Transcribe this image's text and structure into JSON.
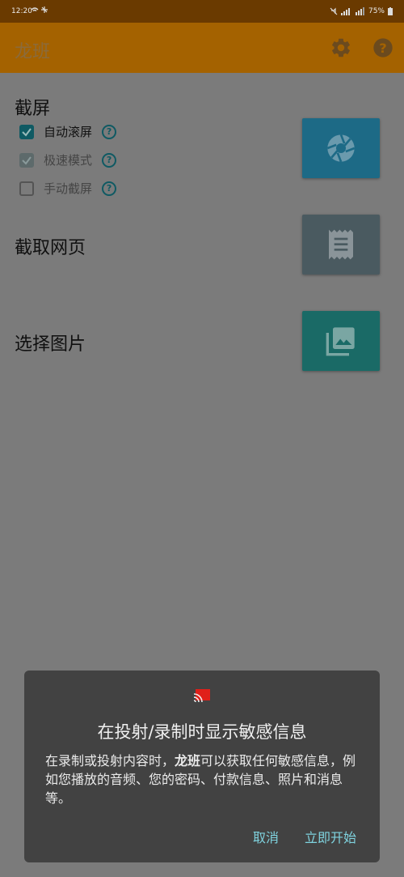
{
  "status_bar": {
    "time": "12:20",
    "battery": "75%"
  },
  "app_bar": {
    "title": "龙班",
    "settings_icon": "gear-icon",
    "help_icon": "help-icon"
  },
  "screenshot_section": {
    "title": "截屏",
    "options": [
      {
        "label": "自动滚屏",
        "checked": true,
        "enabled": true
      },
      {
        "label": "极速模式",
        "checked": true,
        "enabled": false
      },
      {
        "label": "手动截屏",
        "checked": false,
        "enabled": true
      }
    ],
    "button_icon": "shutter-icon",
    "button_color": "#1d6a86"
  },
  "webpage_section": {
    "title": "截取网页",
    "button_icon": "receipt-icon",
    "button_color": "#4a5a60"
  },
  "image_section": {
    "title": "选择图片",
    "button_icon": "photo-library-icon",
    "button_color": "#1a6a66"
  },
  "dialog": {
    "cast_icon": "cast-icon",
    "title": "在投射/录制时显示敏感信息",
    "body_prefix": "在录制或投射内容时，",
    "body_app": "龙班",
    "body_suffix": "可以获取任何敏感信息，例如您播放的音频、您的密码、付款信息、照片和消息等。",
    "cancel_label": "取消",
    "start_label": "立即开始"
  }
}
